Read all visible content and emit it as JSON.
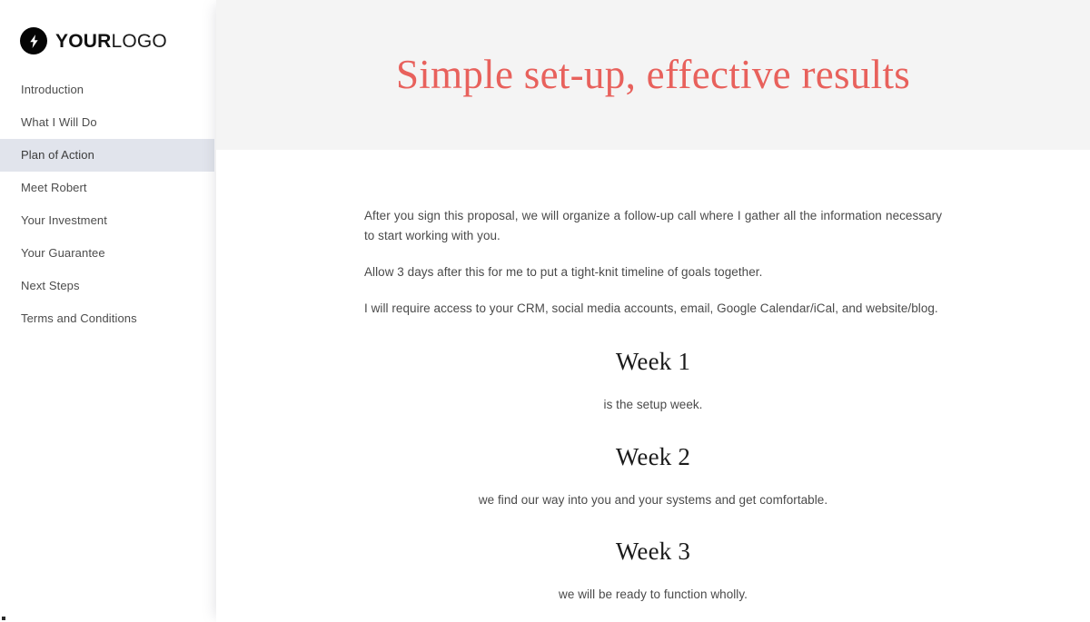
{
  "sidebar": {
    "logo": {
      "icon": "lightning-bolt-icon",
      "text_bold": "YOUR",
      "text_light": "LOGO"
    },
    "items": [
      {
        "label": "Introduction",
        "active": false
      },
      {
        "label": "What I Will Do",
        "active": false
      },
      {
        "label": "Plan of Action",
        "active": true
      },
      {
        "label": "Meet Robert",
        "active": false
      },
      {
        "label": "Your Investment",
        "active": false
      },
      {
        "label": "Your Guarantee",
        "active": false
      },
      {
        "label": "Next Steps",
        "active": false
      },
      {
        "label": "Terms and Conditions",
        "active": false
      }
    ]
  },
  "header": {
    "title": "Simple set-up, effective results"
  },
  "main": {
    "paragraphs": [
      "After you sign this proposal, we will organize a follow-up call where I gather all the information necessary to start working with you.",
      "Allow 3 days after this for me to put a tight-knit timeline of goals together.",
      "I will require access to your CRM, social media accounts, email, Google Calendar/iCal, and website/blog."
    ],
    "weeks": [
      {
        "title": "Week 1",
        "description": "is the setup week."
      },
      {
        "title": "Week 2",
        "description": "we find our way into you and your systems and get comfortable."
      },
      {
        "title": "Week 3",
        "description": "we will be ready to function wholly."
      }
    ]
  },
  "colors": {
    "accent": "#e8615c",
    "header_bg": "#f4f4f4",
    "active_nav_bg": "#e1e4ec",
    "body_text": "#4a4a4a",
    "logo_mark": "#050505"
  }
}
